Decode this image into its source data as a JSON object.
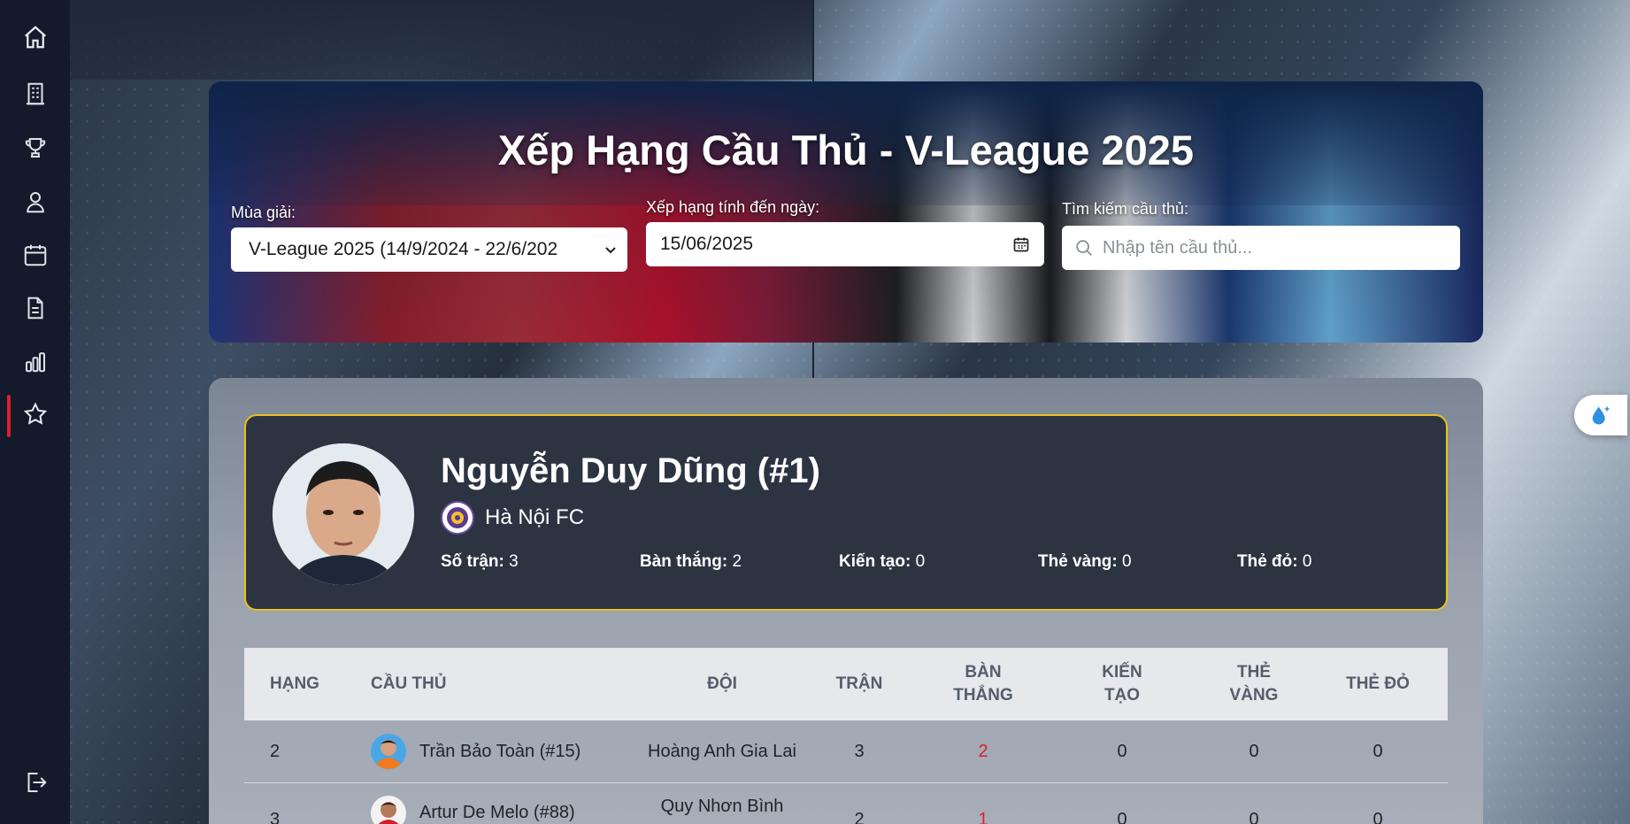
{
  "hero": {
    "title": "Xếp Hạng Cầu Thủ - V-League 2025",
    "season_label": "Mùa giải:",
    "season_value": "V-League 2025 (14/9/2024 - 22/6/202",
    "date_label": "Xếp hạng tính đến ngày:",
    "date_value": "15/06/2025",
    "search_label": "Tìm kiếm cầu thủ:",
    "search_placeholder": "Nhập tên cầu thủ..."
  },
  "featured": {
    "name": "Nguyễn Duy Dũng (#1)",
    "team": "Hà Nội FC",
    "stats": {
      "matches_label": "Số trận:",
      "matches": "3",
      "goals_label": "Bàn thắng:",
      "goals": "2",
      "assists_label": "Kiến tạo:",
      "assists": "0",
      "yellow_label": "Thẻ vàng:",
      "yellow": "0",
      "red_label": "Thẻ đỏ:",
      "red": "0"
    }
  },
  "table": {
    "headers": {
      "rank": "HẠNG",
      "player": "CẦU THỦ",
      "team": "ĐỘI",
      "matches": "TRẬN",
      "goals_1": "BÀN",
      "goals_2": "THẮNG",
      "assists_1": "KIẾN",
      "assists_2": "TẠO",
      "yellow_1": "THẺ",
      "yellow_2": "VÀNG",
      "red": "THẺ ĐỎ"
    },
    "rows": [
      {
        "rank": "2",
        "player": "Trần Bảo Toàn (#15)",
        "team": "Hoàng Anh Gia Lai",
        "matches": "3",
        "goals": "2",
        "assists": "0",
        "yellow": "0",
        "red": "0"
      },
      {
        "rank": "3",
        "player": "Artur De Melo (#88)",
        "team": "Quy Nhơn Bình",
        "matches": "2",
        "goals": "1",
        "assists": "0",
        "yellow": "0",
        "red": "0"
      }
    ]
  },
  "colors": {
    "accent_red": "#e11d2a",
    "card_border": "#e7c21f",
    "sidebar": "#121a2b"
  },
  "icons": [
    "home-icon",
    "building-icon",
    "trophy-icon",
    "user-icon",
    "calendar-icon",
    "document-icon",
    "bar-chart-icon",
    "star-icon",
    "logout-icon",
    "calendar-picker-icon",
    "search-icon",
    "water-drop-icon"
  ]
}
